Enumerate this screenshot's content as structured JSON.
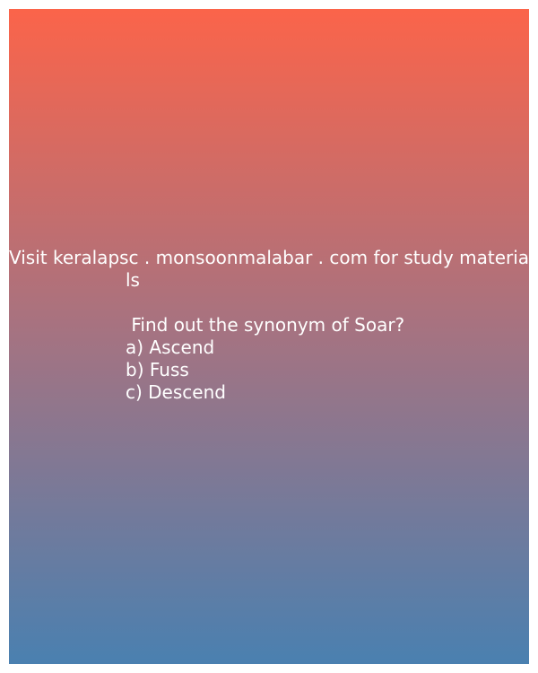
{
  "banner": {
    "line1": "Visit keralapsc . monsoonmalabar . com for study materia",
    "line2": "ls"
  },
  "question": {
    "text": " Find out the synonym of Soar?",
    "options": [
      "a) Ascend",
      "b) Fuss",
      "c) Descend"
    ]
  },
  "colors": {
    "gradient_top": "#fb644a",
    "gradient_middle": "#a47382",
    "gradient_bottom": "#4a80b0",
    "text": "#ffffff"
  }
}
